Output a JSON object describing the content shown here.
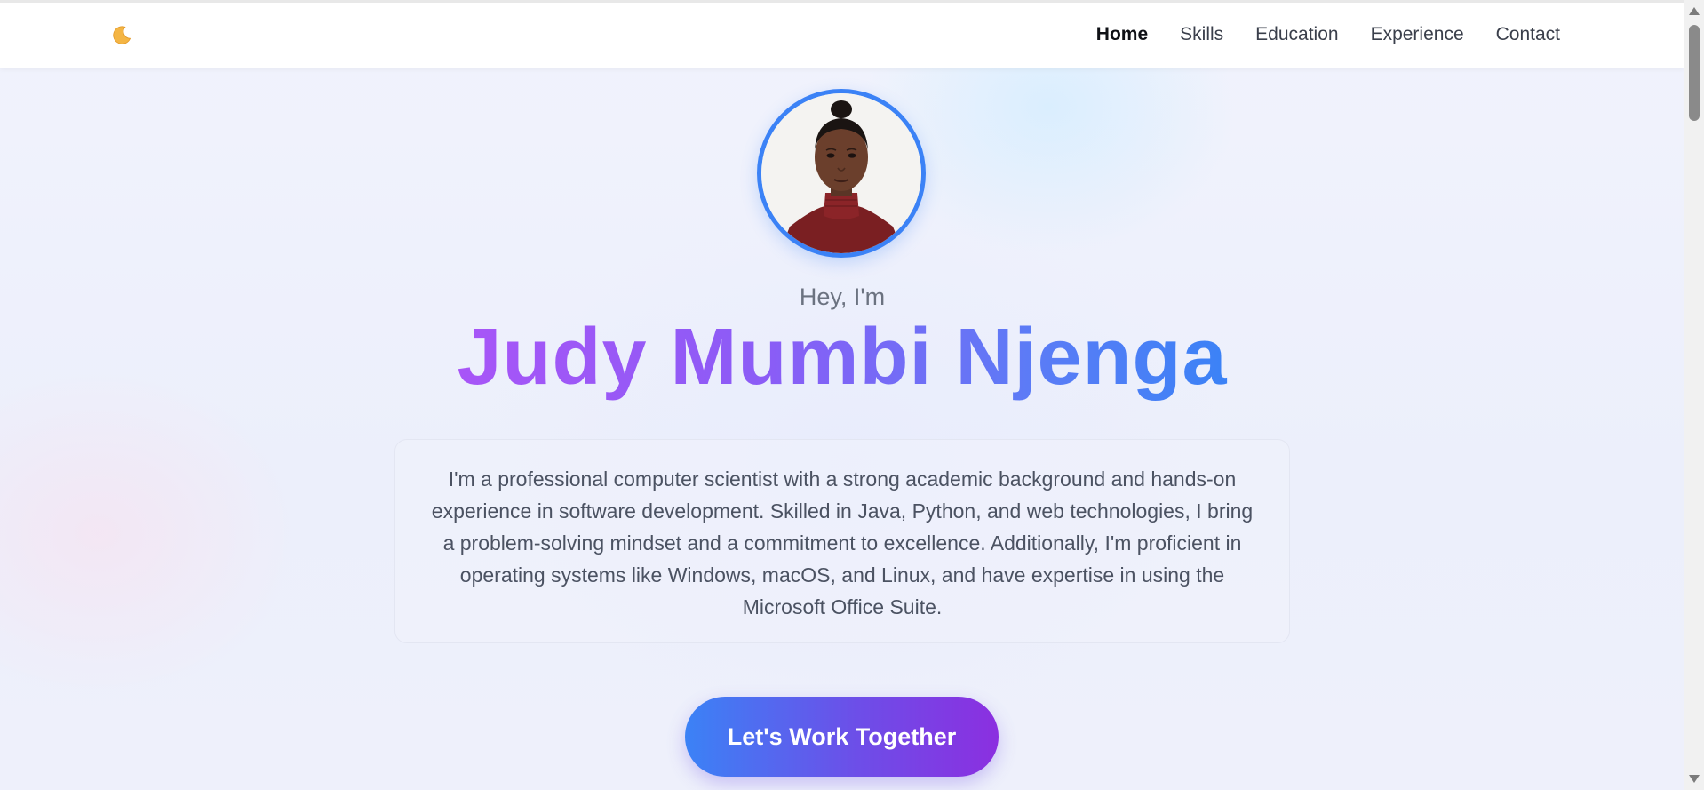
{
  "nav": {
    "theme_icon": "moon-icon",
    "links": [
      {
        "label": "Home",
        "active": true
      },
      {
        "label": "Skills",
        "active": false
      },
      {
        "label": "Education",
        "active": false
      },
      {
        "label": "Experience",
        "active": false
      },
      {
        "label": "Contact",
        "active": false
      }
    ]
  },
  "hero": {
    "greeting": "Hey, I'm",
    "name": "Judy Mumbi Njenga",
    "bio": "I'm a professional computer scientist with a strong academic background and hands-on experience in software development. Skilled in Java, Python, and web technologies, I bring a problem-solving mindset and a commitment to excellence. Additionally, I'm proficient in operating systems like Windows, macOS, and Linux, and have expertise in using the Microsoft Office Suite.",
    "cta_label": "Let's Work Together"
  },
  "colors": {
    "accent_blue": "#3b82f6",
    "accent_purple": "#8b2fe0",
    "name_gradient_start": "#a855f7",
    "name_gradient_end": "#3b82f6"
  }
}
